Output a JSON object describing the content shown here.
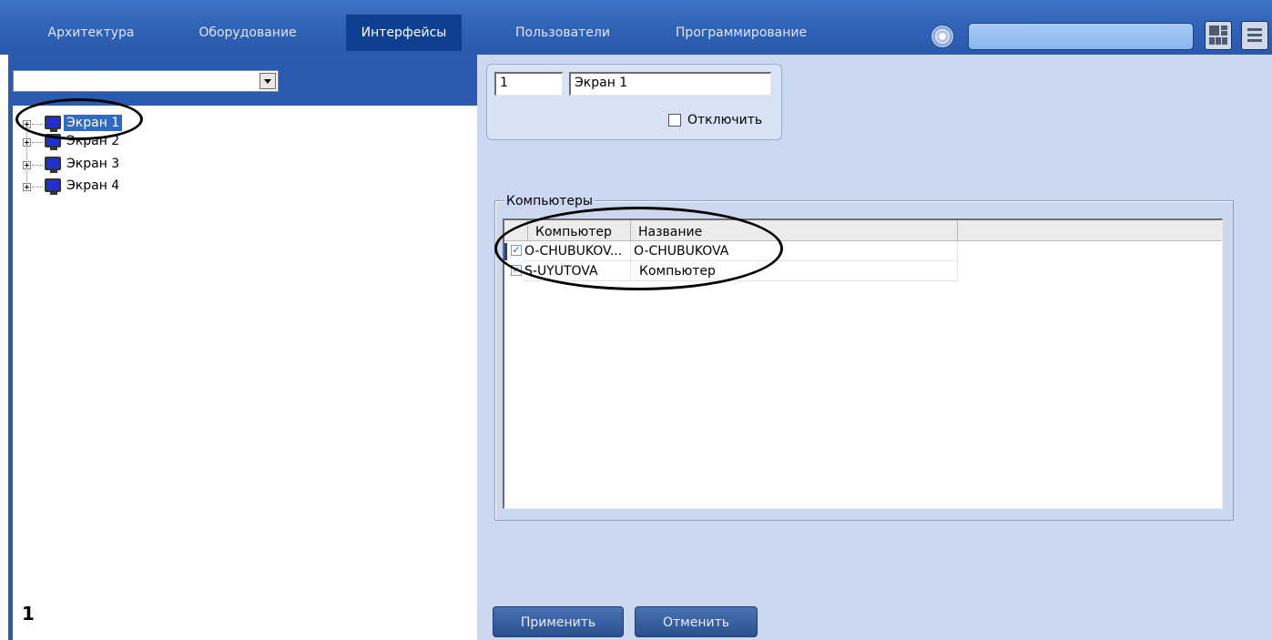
{
  "tabs": [
    {
      "label": "Архитектура",
      "active": false
    },
    {
      "label": "Оборудование",
      "active": false
    },
    {
      "label": "Интерфейсы",
      "active": true
    },
    {
      "label": "Пользователи",
      "active": false
    },
    {
      "label": "Программирование",
      "active": false
    }
  ],
  "search": {
    "value": ""
  },
  "left": {
    "combo_value": "",
    "tree": [
      {
        "label": "Экран 1",
        "selected": true
      },
      {
        "label": "Экран 2",
        "selected": false
      },
      {
        "label": "Экран 3",
        "selected": false
      },
      {
        "label": "Экран 4",
        "selected": false
      }
    ],
    "corner_number": "1"
  },
  "right": {
    "id_value": "1",
    "name_value": "Экран 1",
    "disable_label": "Отключить",
    "disable_checked": false,
    "computers_label": "Компьютеры",
    "columns": [
      "Компьютер",
      "Название"
    ],
    "rows": [
      {
        "computer": "O-CHUBUKOV...",
        "name": "O-CHUBUKOVA",
        "checked": true
      },
      {
        "computer": "S-UYUTOVA",
        "name": "Компьютер",
        "checked": true
      }
    ]
  },
  "buttons": {
    "apply": "Применить",
    "cancel": "Отменить"
  },
  "colors": {
    "top_bar": "#2f61b6",
    "active_tab": "#0f3f91",
    "left_panel": "#2b5bb0",
    "right_panel": "#cbd8f0"
  }
}
